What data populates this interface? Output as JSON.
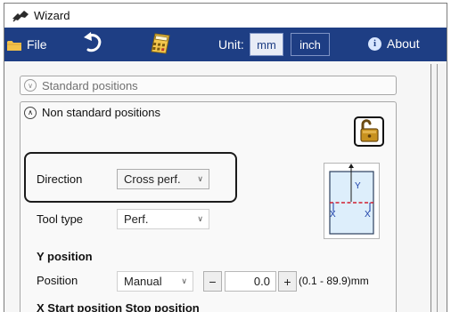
{
  "window": {
    "title": "Wizard"
  },
  "menubar": {
    "file_label": "File",
    "undo_icon": "undo-arrow-icon",
    "calculator_icon": "calculator-icon",
    "unit_label": "Unit:",
    "unit_options": [
      "mm",
      "inch"
    ],
    "unit_selected": "mm",
    "about_label": "About",
    "background_color": "#1e3e84"
  },
  "expanders": {
    "standard_positions": "Standard positions",
    "non_standard_positions": "Non standard positions"
  },
  "lock": {
    "icon": "open-padlock-icon",
    "state": "unlocked"
  },
  "form": {
    "direction": {
      "label": "Direction",
      "value": "Cross perf."
    },
    "tool_type": {
      "label": "Tool type",
      "value": "Perf."
    }
  },
  "y_position": {
    "heading": "Y position",
    "position_label": "Position",
    "mode": "Manual",
    "minus": "−",
    "plus": "+",
    "value": "0.0",
    "range": "(0.1 - 89.9)mm"
  },
  "x_position": {
    "heading": "X Start position Stop position"
  },
  "diagram": {
    "y_label": "Y",
    "x_left_label": "X",
    "x_right_label": "X",
    "accent_color": "#1a3ea8",
    "cut_line_color": "#d21f2f"
  }
}
